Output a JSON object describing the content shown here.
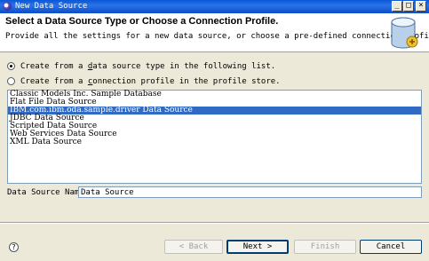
{
  "window": {
    "title": "New Data Source",
    "controls": {
      "minimize": "_",
      "maximize": "□",
      "close": "×"
    }
  },
  "header": {
    "title": "Select a Data Source Type or Choose a Connection Profile.",
    "description": "Provide all the settings for a new data source, or choose a pre-defined connection profile.",
    "icon": "database-icon"
  },
  "options": {
    "radio1": {
      "pre": "Create from a ",
      "key": "d",
      "post": "ata source type in the following list.",
      "selected": true
    },
    "radio2": {
      "pre": "Create from a ",
      "key": "c",
      "post": "onnection profile in the profile store.",
      "selected": false
    }
  },
  "datasource_types": [
    "Classic Models Inc. Sample Database",
    "Flat File Data Source",
    "IBM.com.ibm.oda.sample.driver Data Source",
    "JDBC Data Source",
    "Scripted Data Source",
    "Web Services Data Source",
    "XML Data Source"
  ],
  "selected_index": 2,
  "name_field": {
    "label": "Data Source Name:",
    "value": "Data Source"
  },
  "buttons": {
    "help": "?",
    "back": "< Back",
    "next": "Next >",
    "finish": "Finish",
    "cancel": "Cancel"
  },
  "colors": {
    "selection": "#316ac5",
    "titlebar": "#0a58d8"
  }
}
